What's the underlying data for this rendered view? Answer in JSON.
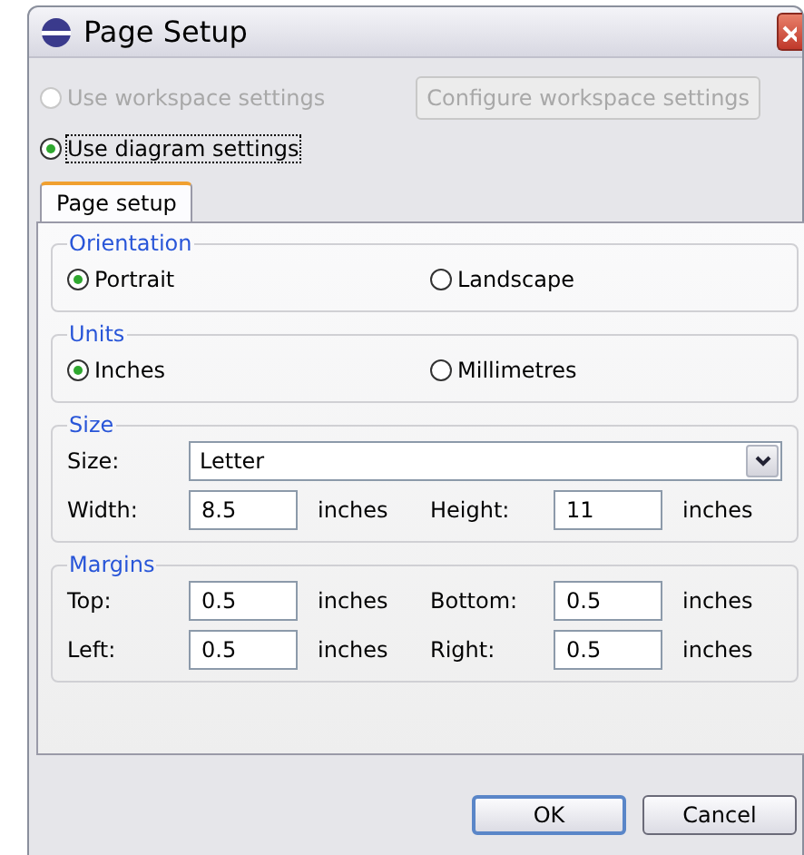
{
  "window": {
    "title": "Page Setup"
  },
  "scope_options": [
    {
      "label": "Use workspace settings",
      "selected": false,
      "disabled": true,
      "focused": false
    },
    {
      "label": "Use diagram settings",
      "selected": true,
      "disabled": false,
      "focused": true
    }
  ],
  "configure_button": {
    "label": "Configure workspace settings",
    "disabled": true
  },
  "tabs": [
    {
      "label": "Page setup",
      "selected": true
    }
  ],
  "orientation": {
    "title": "Orientation",
    "options": [
      {
        "label": "Portrait",
        "selected": true
      },
      {
        "label": "Landscape",
        "selected": false
      }
    ]
  },
  "units": {
    "title": "Units",
    "options": [
      {
        "label": "Inches",
        "selected": true
      },
      {
        "label": "Millimetres",
        "selected": false
      }
    ]
  },
  "size": {
    "title": "Size",
    "size_label": "Size:",
    "size_value": "Letter",
    "fields": [
      {
        "label": "Width:",
        "value": "8.5",
        "unit": "inches"
      },
      {
        "label": "Height:",
        "value": "11",
        "unit": "inches"
      }
    ]
  },
  "margins": {
    "title": "Margins",
    "fields": [
      {
        "label": "Top:",
        "value": "0.5",
        "unit": "inches"
      },
      {
        "label": "Bottom:",
        "value": "0.5",
        "unit": "inches"
      },
      {
        "label": "Left:",
        "value": "0.5",
        "unit": "inches"
      },
      {
        "label": "Right:",
        "value": "0.5",
        "unit": "inches"
      }
    ]
  },
  "buttons": [
    {
      "label": "OK",
      "default": true
    },
    {
      "label": "Cancel",
      "default": false
    }
  ]
}
